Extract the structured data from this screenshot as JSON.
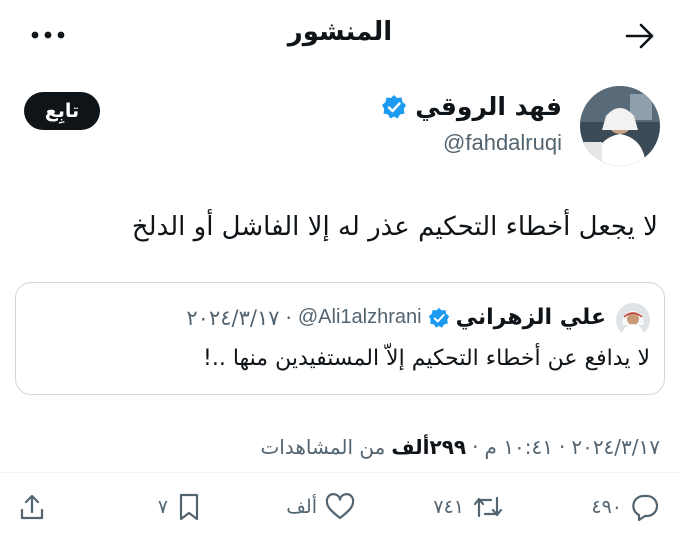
{
  "header": {
    "title": "المنشور"
  },
  "author": {
    "name": "فهد الروقي",
    "handle": "@fahdalruqi",
    "follow_label": "تابِع"
  },
  "post": {
    "text": "لا يجعل أخطاء التحكيم عذر له إلا الفاشل أو الدلخ"
  },
  "quote": {
    "name": "علي الزهراني",
    "handle": "@Ali1alzhrani",
    "separator": "·",
    "date": "٢٠٢٤/٣/١٧",
    "text": "لا يدافع عن أخطاء التحكيم إلاّ المستفيدين منها ..!"
  },
  "meta": {
    "time": "١٠:٤١ م",
    "separator": "·",
    "date": "٢٠٢٤/٣/١٧",
    "views_count": "٢٩٩ألف",
    "views_label": "من المشاهدات"
  },
  "actions": {
    "replies": "٤٩٠",
    "reposts": "٧٤١",
    "likes": "ألف",
    "bookmarks": "٧"
  },
  "colors": {
    "verified": "#1d9bf0",
    "text": "#0f1419",
    "muted": "#536471"
  }
}
